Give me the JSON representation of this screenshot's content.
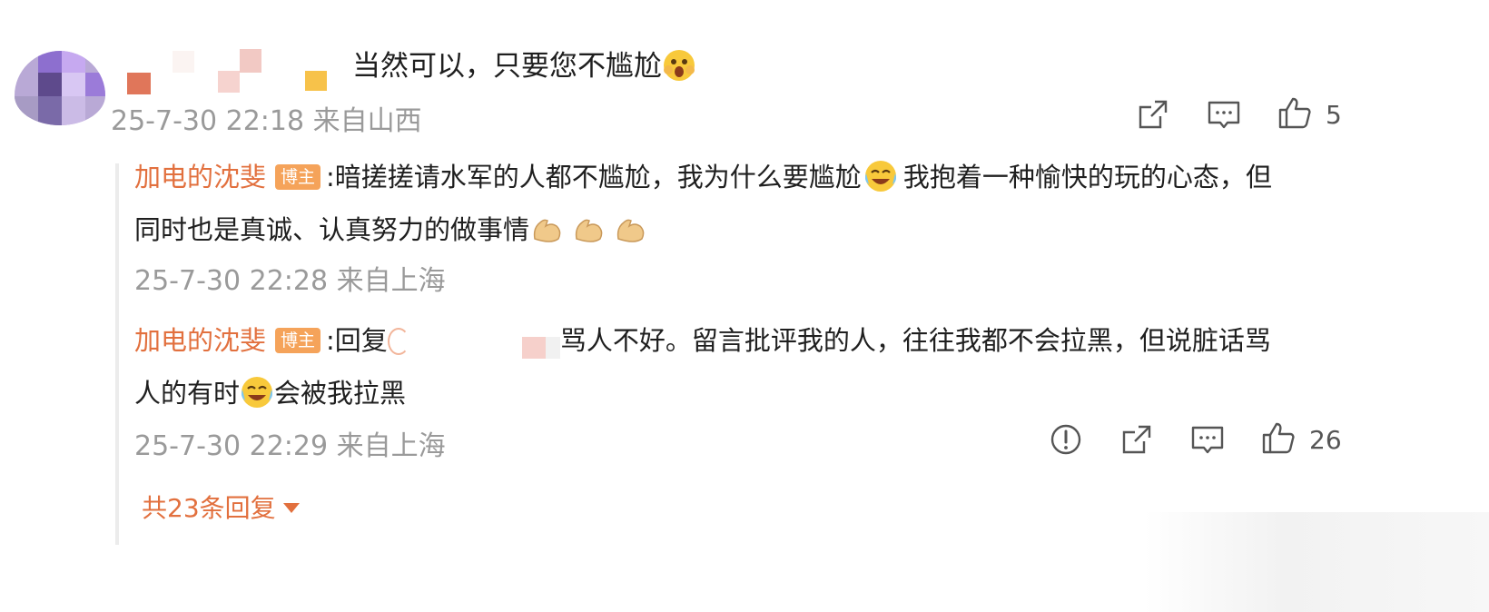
{
  "comment": {
    "text": "当然可以，只要您不尴尬",
    "emoji": "shocked-face-emoji",
    "timestamp": "25-7-30 22:18 来自山西",
    "like_count": "5"
  },
  "replies": [
    {
      "username": "加电的沈斐",
      "badge": "博主",
      "line1_a": ":暗搓搓请水军的人都不尴尬，我为什么要尴尬",
      "line1_b": "我抱着一种愉快的玩的心态，但",
      "line2": "同时也是真诚、认真努力的做事情",
      "timestamp": "25-7-30 22:28 来自上海"
    },
    {
      "username": "加电的沈斐",
      "badge": "博主",
      "line1_a": ":回复",
      "line1_b": "骂人不好。留言批评我的人，往往我都不会拉黑，但说脏话骂",
      "line2_a": "人的有时",
      "line2_b": "会被我拉黑",
      "timestamp": "25-7-30 22:29 来自上海",
      "like_count": "26"
    }
  ],
  "more_replies": "共23条回复",
  "colors": {
    "username": "#e2703e",
    "badge": "#f5a35a",
    "timestamp": "#9a9a9a",
    "text": "#1f1f1f"
  },
  "icons": [
    "share-icon",
    "comment-icon",
    "like-icon",
    "report-icon",
    "caret-down-icon"
  ]
}
